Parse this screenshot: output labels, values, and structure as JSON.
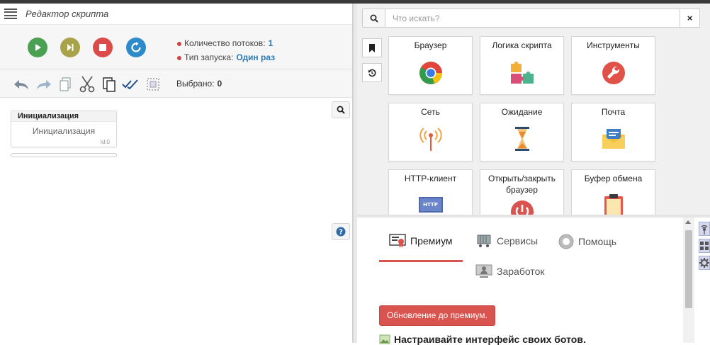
{
  "editor": {
    "title": "Редактор скрипта",
    "threads_label": "Количество потоков:",
    "threads_value": "1",
    "launch_label": "Тип запуска:",
    "launch_value": "Один раз",
    "selected_label": "Выбрано:",
    "selected_value": "0",
    "block": {
      "header": "Инициализация",
      "body": "Инициализация",
      "id": "Id:0"
    }
  },
  "palette": {
    "search_placeholder": "Что искать?",
    "clear": "×",
    "tiles": [
      {
        "label": "Браузер",
        "icon": "chrome-icon"
      },
      {
        "label": "Логика скрипта",
        "icon": "puzzle-icon"
      },
      {
        "label": "Инструменты",
        "icon": "wrench-icon"
      },
      {
        "label": "Сеть",
        "icon": "antenna-icon"
      },
      {
        "label": "Ожидание",
        "icon": "hourglass-icon"
      },
      {
        "label": "Почта",
        "icon": "envelope-icon"
      },
      {
        "label": "HTTP-клиент",
        "icon": "http-icon"
      },
      {
        "label": "Открыть/закрыть браузер",
        "icon": "power-icon"
      },
      {
        "label": "Буфер обмена",
        "icon": "clipboard-icon"
      }
    ],
    "http_badge": "HTTP"
  },
  "premium": {
    "tabs": [
      {
        "label": "Премиум",
        "active": true
      },
      {
        "label": "Сервисы",
        "active": false
      },
      {
        "label": "Помощь",
        "active": false
      },
      {
        "label": "Заработок",
        "active": false
      }
    ],
    "upgrade_button": "Обновление до премиум.",
    "promo": "Настраивайте интерфейс своих ботов."
  },
  "colors": {
    "play": "#4aa151",
    "step": "#a8a24a",
    "stop": "#dc4b4b",
    "restart": "#2e8bc9",
    "accent_red": "#d9534f",
    "link_blue": "#2a79b7"
  }
}
